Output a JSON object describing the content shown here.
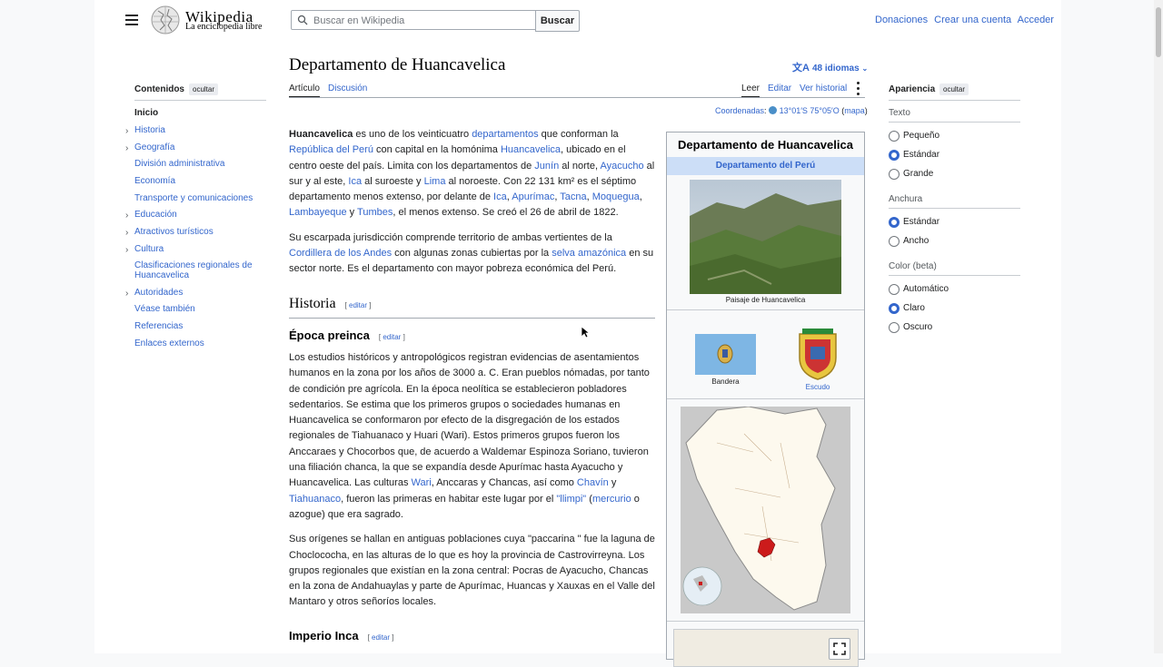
{
  "header": {
    "wordmark": "Wikipedia",
    "tagline": "La enciclopedia libre",
    "search_placeholder": "Buscar en Wikipedia",
    "search_button": "Buscar",
    "user_links": [
      "Donaciones",
      "Crear una cuenta",
      "Acceder"
    ]
  },
  "toc": {
    "title": "Contenidos",
    "hide": "ocultar",
    "items": [
      {
        "label": "Inicio",
        "current": true,
        "expandable": false
      },
      {
        "label": "Historia",
        "expandable": true
      },
      {
        "label": "Geografía",
        "expandable": true
      },
      {
        "label": "División administrativa",
        "expandable": false
      },
      {
        "label": "Economía",
        "expandable": false
      },
      {
        "label": "Transporte y comunicaciones",
        "expandable": false
      },
      {
        "label": "Educación",
        "expandable": true
      },
      {
        "label": "Atractivos turísticos",
        "expandable": true
      },
      {
        "label": "Cultura",
        "expandable": true
      },
      {
        "label": "Clasificaciones regionales de Huancavelica",
        "expandable": false
      },
      {
        "label": "Autoridades",
        "expandable": true
      },
      {
        "label": "Véase también",
        "expandable": false
      },
      {
        "label": "Referencias",
        "expandable": false
      },
      {
        "label": "Enlaces externos",
        "expandable": false
      }
    ]
  },
  "article": {
    "title": "Departamento de Huancavelica",
    "languages": "48 idiomas",
    "tabs": {
      "article": "Artículo",
      "talk": "Discusión",
      "read": "Leer",
      "edit": "Editar",
      "history": "Ver historial"
    },
    "coords_label": "Coordenadas",
    "coords_value": "13°01′S 75°05′O",
    "coords_map": "mapa",
    "edit_label": "editar",
    "h2_historia": "Historia",
    "h3_preinca": "Época preinca",
    "h3_inca": "Imperio Inca"
  },
  "infobox": {
    "title": "Departamento de Huancavelica",
    "subtitle": "Departamento del Perú",
    "landscape_caption": "Paisaje de Huancavelica",
    "flag_caption": "Bandera",
    "shield_caption": "Escudo"
  },
  "appearance": {
    "title": "Apariencia",
    "hide": "ocultar",
    "text_group": "Texto",
    "text_options": [
      "Pequeño",
      "Estándar",
      "Grande"
    ],
    "width_group": "Anchura",
    "width_options": [
      "Estándar",
      "Ancho"
    ],
    "color_group": "Color (beta)",
    "color_options": [
      "Automático",
      "Claro",
      "Oscuro"
    ]
  },
  "colors": {
    "link": "#3366cc",
    "accent_blue": "#ccdef7",
    "region_red": "#cc1b1b"
  }
}
